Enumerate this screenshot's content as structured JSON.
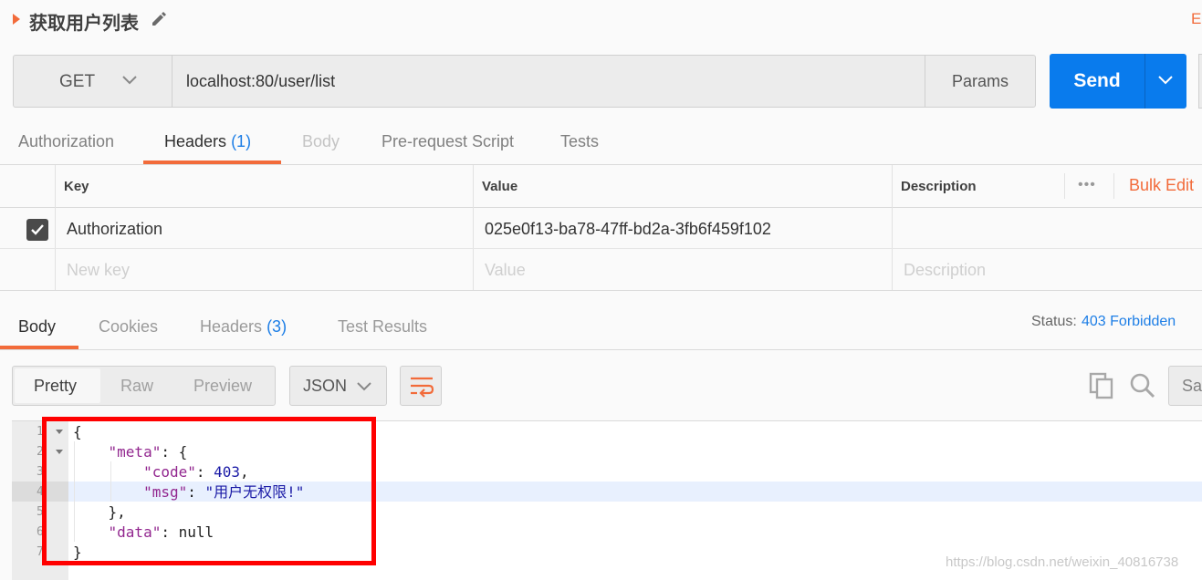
{
  "request": {
    "title": "获取用户列表",
    "examples_label": "E:",
    "method": "GET",
    "url": "localhost:80/user/list",
    "params_label": "Params",
    "send_label": "Send"
  },
  "request_tabs": [
    {
      "label": "Authorization"
    },
    {
      "label": "Headers",
      "count": "(1)"
    },
    {
      "label": "Body"
    },
    {
      "label": "Pre-request Script"
    },
    {
      "label": "Tests"
    }
  ],
  "headers_table": {
    "columns": [
      "Key",
      "Value",
      "Description"
    ],
    "bulk_edit_label": "Bulk Edit",
    "more_label": "•••",
    "rows": [
      {
        "key": "Authorization",
        "value": "025e0f13-ba78-47ff-bd2a-3fb6f459f102",
        "description": "",
        "checked": true
      }
    ],
    "placeholders": {
      "key": "New key",
      "value": "Value",
      "description": "Description"
    }
  },
  "response_tabs": [
    {
      "label": "Body"
    },
    {
      "label": "Cookies"
    },
    {
      "label": "Headers",
      "count": "(3)"
    },
    {
      "label": "Test Results"
    }
  ],
  "status": {
    "label": "Status:",
    "value": "403 Forbidden"
  },
  "response_view": {
    "modes": [
      "Pretty",
      "Raw",
      "Preview"
    ],
    "format": "JSON",
    "save_label": "Sav"
  },
  "code": {
    "line_numbers": [
      "1",
      "2",
      "3",
      "4",
      "5",
      "6",
      "7"
    ],
    "lines": {
      "l1": "{",
      "l2_key": "\"meta\"",
      "l2_rest": ": {",
      "l3_key": "\"code\"",
      "l3_sep": ": ",
      "l3_val": "403",
      "l3_end": ",",
      "l4_key": "\"msg\"",
      "l4_sep": ": ",
      "l4_val": "\"用户无权限!\"",
      "l5": "},",
      "l6_key": "\"data\"",
      "l6_rest": ": null",
      "l7": "}"
    }
  },
  "watermark": "https://blog.csdn.net/weixin_40816738",
  "colors": {
    "accent": "#f26b3a",
    "primary": "#097bed",
    "link": "#1d7ee6",
    "highlight_box": "#ff0000"
  }
}
